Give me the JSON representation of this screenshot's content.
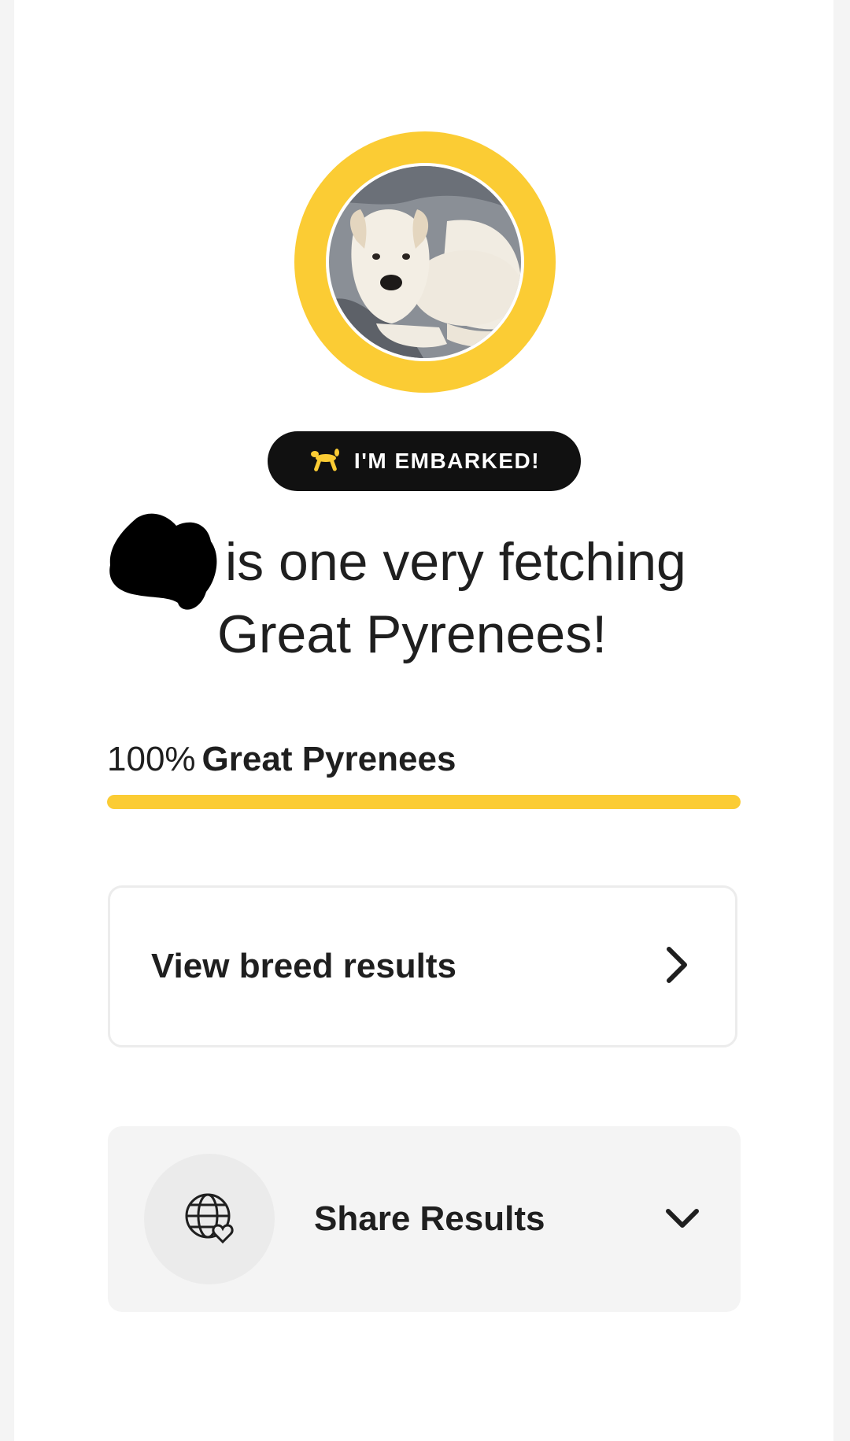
{
  "profile": {
    "badge_label": "I'M EMBARKED!",
    "badge_icon": "balloon-dog-icon"
  },
  "headline": {
    "line1": "is one very fetching",
    "line2": "Great Pyrenees!"
  },
  "breed": {
    "percent_label": "100%",
    "name": "Great Pyrenees",
    "percent": 100
  },
  "actions": {
    "view_results_label": "View breed results",
    "view_results_icon": "chevron-right-icon",
    "share_label": "Share Results",
    "share_icon": "globe-heart-icon",
    "share_toggle_icon": "chevron-down-icon"
  },
  "colors": {
    "accent": "#fbcc34",
    "badge_bg": "#111111",
    "text": "#1f1f1f",
    "panel_bg": "#f4f4f4"
  }
}
